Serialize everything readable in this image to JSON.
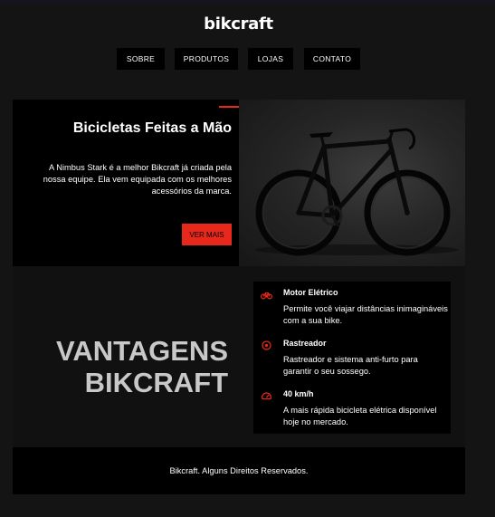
{
  "header": {
    "logo": "bikcraft",
    "nav": [
      "SOBRE",
      "PRODUTOS",
      "LOJAS",
      "CONTATO"
    ]
  },
  "hero": {
    "title": "Bicicletas Feitas a Mão",
    "description": "A Nimbus Stark é a melhor Bikcraft já criada pela nossa equipe. Ela vem equipada com os melhores acessórios da marca.",
    "cta_label": "VER MAIS",
    "image_subject": "road-bicycle-photo"
  },
  "advantages": {
    "title_line1": "VANTAGENS",
    "title_line2": "BIKCRAFT",
    "items": [
      {
        "name": "Motor Elétrico",
        "description": "Permite você viajar distâncias inimagináveis com a sua bike.",
        "icon": "bicycle-icon"
      },
      {
        "name": "Rastreador",
        "description": "Rastreador e sistema anti-furto para garantir o seu sossego.",
        "icon": "target-icon"
      },
      {
        "name": "40 km/h",
        "description": "A mais rápida bicicleta elétrica disponível hoje no mercado.",
        "icon": "speedometer-icon"
      }
    ]
  },
  "footer": {
    "text": "Bikcraft. Alguns Direitos Reservados."
  },
  "colors": {
    "accent": "#e8281a",
    "background": "#141414",
    "panel": "#000000",
    "heading_gray": "#c8c8c8"
  }
}
